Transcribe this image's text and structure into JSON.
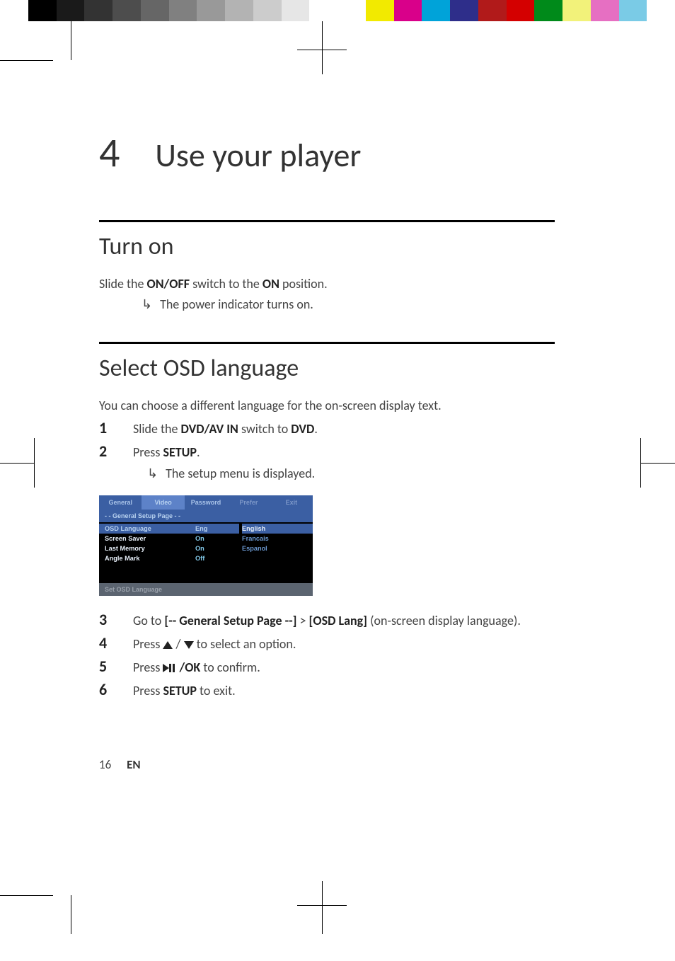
{
  "chapter": {
    "number": "4",
    "title": "Use your player"
  },
  "section_turn_on": {
    "heading": "Turn on",
    "text_prefix": "Slide the ",
    "text_b1": "ON/OFF",
    "text_mid": " switch to the ",
    "text_b2": "ON",
    "text_suffix": " position.",
    "result": "The power indicator turns on."
  },
  "section_osd": {
    "heading": "Select OSD language",
    "intro": "You can choose a different language for the on-screen display text.",
    "steps": {
      "s1": {
        "num": "1",
        "pre": "Slide the ",
        "b1": "DVD/AV IN",
        "mid": " switch to ",
        "b2": "DVD",
        "post": "."
      },
      "s2": {
        "num": "2",
        "pre": "Press ",
        "b1": "SETUP",
        "post": ".",
        "result": "The setup menu is displayed."
      },
      "s3": {
        "num": "3",
        "pre": "Go to ",
        "b1": "[-- General Setup Page --]",
        "gt": " > ",
        "b2": "[OSD Lang]",
        "post": " (on-screen display language)."
      },
      "s4": {
        "num": "4",
        "pre": "Press ",
        "slash": " / ",
        "post": " to select an option."
      },
      "s5": {
        "num": "5",
        "pre": "Press ",
        "ok": " /OK",
        "post": " to confirm."
      },
      "s6": {
        "num": "6",
        "pre": "Press ",
        "b1": "SETUP",
        "post": " to exit."
      }
    }
  },
  "osd": {
    "tabs": {
      "general": "General",
      "video": "Video",
      "password": "Password",
      "prefer": "Prefer",
      "exit": "Exit"
    },
    "subheader": "- -    General Setup Page   - -",
    "rows": {
      "osd_lang": "OSD  Language",
      "screen_saver": "Screen Saver",
      "last_memory": "Last Memory",
      "angle_mark": "Angle Mark"
    },
    "vals": {
      "eng": "Eng",
      "on1": "On",
      "on2": "On",
      "off": "Off"
    },
    "opts": {
      "english": "English",
      "francais": "Francais",
      "espanol": "Espanol"
    },
    "footer": "Set OSD Language"
  },
  "footer": {
    "page": "16",
    "lang": "EN"
  },
  "colors": [
    "#ffffff",
    "#000000",
    "#1a1a1a",
    "#333333",
    "#4d4d4d",
    "#666666",
    "#808080",
    "#999999",
    "#b3b3b3",
    "#cccccc",
    "#e6e6e6",
    "#ffffff",
    "#ffffff",
    "#f2ea00",
    "#d9008a",
    "#00a3d9",
    "#2e2e8a",
    "#b11a1a",
    "#d40000",
    "#008a1a",
    "#f2f27a",
    "#e66fc2",
    "#7acbe6",
    "#ffffff"
  ]
}
